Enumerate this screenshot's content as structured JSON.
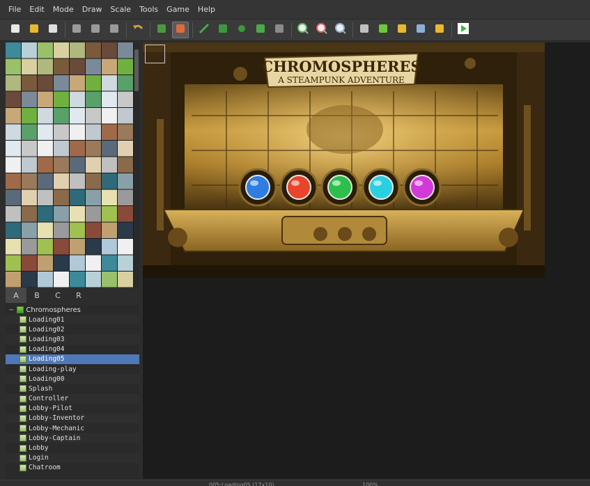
{
  "menu": [
    "File",
    "Edit",
    "Mode",
    "Draw",
    "Scale",
    "Tools",
    "Game",
    "Help"
  ],
  "toolbar": {
    "tools": [
      "new-file-icon",
      "open-folder-icon",
      "save-icon",
      "cut-icon",
      "copy-icon",
      "paste-icon",
      "undo-icon",
      "map-layer-icon",
      "event-layer-icon",
      "pencil-icon",
      "rectangle-icon",
      "ellipse-icon",
      "fill-icon",
      "shadow-pen-icon",
      "zoom-in-icon",
      "zoom-out-icon",
      "zoom-reset-icon",
      "database-icon",
      "plugins-icon",
      "sound-icon",
      "resource-icon",
      "character-icon",
      "playtest-icon"
    ],
    "active": "event-layer-icon"
  },
  "layer_tabs": [
    "A",
    "B",
    "C",
    "R"
  ],
  "layer_active": "A",
  "tree": {
    "root": "Chromospheres",
    "items": [
      "Loading01",
      "Loading02",
      "Loading03",
      "Loading04",
      "Loading05",
      "Loading-play",
      "Loading00",
      "Splash",
      "Controller",
      "Lobby-Pilot",
      "Lobby-Inventor",
      "Lobby-Mechanic",
      "Lobby-Captain",
      "Lobby",
      "Login",
      "Chatroom"
    ],
    "selected": "Loading05"
  },
  "map": {
    "title_line1": "CHROMOSPHERES",
    "title_line2": "A STEAMPUNK ADVENTURE",
    "orbs": [
      "#2f7de0",
      "#e8452a",
      "#2cc04a",
      "#2ad0e0",
      "#d23ad8"
    ]
  },
  "status": {
    "map_info": "005:Loading05 (17x10)",
    "zoom": "100%"
  },
  "colors": {
    "selection": "#4f78b8",
    "map_bg": "#3a2a10",
    "brass": "#c9a04a"
  }
}
